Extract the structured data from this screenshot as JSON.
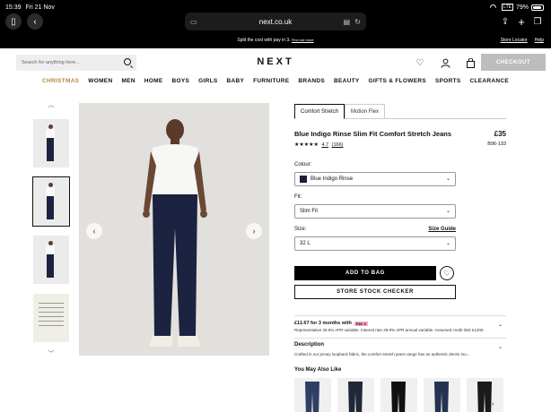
{
  "status": {
    "time": "15:39",
    "date": "Fri 21 Nov",
    "battery": "79%",
    "lte": "LTE"
  },
  "browser": {
    "url": "next.co.uk"
  },
  "promo": {
    "text": "Split the cost with pay in 3.",
    "link": "Find out more",
    "store_locator": "Store Locator",
    "help": "Help"
  },
  "header": {
    "search_placeholder": "Search for anything here...",
    "logo": "NEXT",
    "checkout": "CHECKOUT"
  },
  "nav": [
    "CHRISTMAS",
    "WOMEN",
    "MEN",
    "HOME",
    "BOYS",
    "GIRLS",
    "BABY",
    "FURNITURE",
    "BRANDS",
    "BEAUTY",
    "GIFTS & FLOWERS",
    "SPORTS",
    "CLEARANCE"
  ],
  "product": {
    "tabs": [
      "Comfort Stretch",
      "Motion Flex"
    ],
    "title": "Blue Indigo Rinse Slim Fit Comfort Stretch Jeans",
    "price": "£35",
    "code": "B96-133",
    "stars": "★★★★★",
    "rating": "4.7",
    "reviews": "(166)",
    "colour_label": "Colour:",
    "colour_value": "Blue Indigo Rinse",
    "fit_label": "Fit:",
    "fit_value": "Slim Fit",
    "size_label": "Size:",
    "size_guide": "Size Guide",
    "size_value": "32 L",
    "add_to_bag": "ADD TO BAG",
    "store_stock": "STORE STOCK CHECKER",
    "credit_title": "£11.67 for 3 months with",
    "credit_badge": "PAY 3",
    "credit_text": "Representative 29.9% APR variable. Interest rate 29.9% APR annual variable. Assumed credit limit £1200.",
    "description_title": "Description",
    "description_text": "Crafted in our jersey loopback fabric, the comfort stretch jeans range has an authentic denim loo...",
    "you_may_also_like": "You May Also Like"
  },
  "colors": {
    "accent_christmas": "#b38b3f",
    "denim": "#1b2340"
  }
}
